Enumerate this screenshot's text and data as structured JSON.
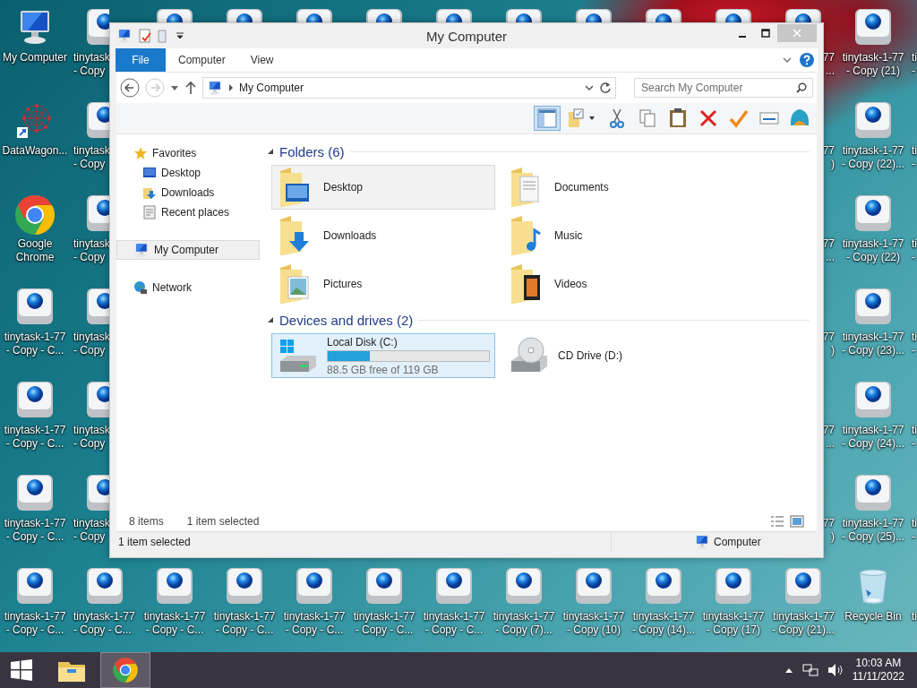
{
  "desktop": {
    "columns": [
      {
        "cut_left": false,
        "cut_right": false,
        "icons": [
          {
            "kind": "computer",
            "lines": [
              "My Computer"
            ]
          },
          {
            "kind": "datawagon",
            "lines": [
              "DataWagon..."
            ]
          },
          {
            "kind": "chrome",
            "lines": [
              "Google",
              "Chrome"
            ]
          },
          {
            "kind": "tinytask",
            "lines": [
              "tinytask-1-77",
              "- Copy - C..."
            ]
          },
          {
            "kind": "tinytask",
            "lines": [
              "tinytask-1-77",
              "- Copy - C..."
            ]
          },
          {
            "kind": "tinytask",
            "lines": [
              "tinytask-1-77",
              "- Copy - C..."
            ]
          },
          {
            "kind": "tinytask",
            "lines": [
              "tinytask-1-77",
              "- Copy - C..."
            ]
          }
        ]
      },
      {
        "cut_left": false,
        "cut_right": true,
        "icons": [
          {
            "kind": "tinytask_left",
            "lines": [
              "tinytask",
              "- Copy"
            ]
          },
          {
            "kind": "tinytask_left",
            "lines": [
              "tinytask",
              "- Copy"
            ]
          },
          {
            "kind": "tinytask_left",
            "lines": [
              "tinytask",
              "- Copy"
            ]
          },
          {
            "kind": "tinytask_left",
            "lines": [
              "tinytask",
              "- Copy"
            ]
          },
          {
            "kind": "tinytask_left",
            "lines": [
              "tinytask",
              "- Copy"
            ]
          },
          {
            "kind": "tinytask_left",
            "lines": [
              "tinytask",
              "- Copy"
            ]
          },
          {
            "kind": "tinytask",
            "lines": [
              "tinytask-1-77",
              "- Copy - C..."
            ]
          }
        ]
      },
      {
        "cut_left": false,
        "cut_right": false,
        "icons": [
          {
            "kind": "tinytask_top"
          },
          {
            "kind": "tinytask",
            "lines": [
              "tinytask-1-77",
              "- Copy - C..."
            ]
          }
        ]
      },
      {
        "cut_left": false,
        "cut_right": false,
        "icons": [
          {
            "kind": "tinytask_top"
          },
          {
            "kind": "tinytask",
            "lines": [
              "tinytask-1-77",
              "- Copy - C..."
            ]
          }
        ]
      },
      {
        "cut_left": false,
        "cut_right": false,
        "icons": [
          {
            "kind": "tinytask_top"
          },
          {
            "kind": "tinytask",
            "lines": [
              "tinytask-1-77",
              "- Copy - C..."
            ]
          }
        ]
      },
      {
        "cut_left": false,
        "cut_right": false,
        "icons": [
          {
            "kind": "tinytask_top"
          },
          {
            "kind": "tinytask",
            "lines": [
              "tinytask-1-77",
              "- Copy - C..."
            ]
          }
        ]
      },
      {
        "cut_left": false,
        "cut_right": false,
        "icons": [
          {
            "kind": "tinytask_top"
          },
          {
            "kind": "tinytask",
            "lines": [
              "tinytask-1-77",
              "- Copy - C..."
            ]
          }
        ]
      },
      {
        "cut_left": false,
        "cut_right": false,
        "icons": [
          {
            "kind": "tinytask_top"
          },
          {
            "kind": "tinytask",
            "lines": [
              "tinytask-1-77",
              "- Copy (7)..."
            ]
          }
        ]
      },
      {
        "cut_left": false,
        "cut_right": false,
        "icons": [
          {
            "kind": "tinytask_top"
          },
          {
            "kind": "tinytask",
            "lines": [
              "tinytask-1-77",
              "- Copy (10)"
            ]
          }
        ]
      },
      {
        "cut_left": false,
        "cut_right": false,
        "icons": [
          {
            "kind": "tinytask_top"
          },
          {
            "kind": "tinytask",
            "lines": [
              "tinytask-1-77",
              "- Copy (14)..."
            ]
          }
        ]
      },
      {
        "cut_left": false,
        "cut_right": false,
        "icons": [
          {
            "kind": "tinytask_top"
          },
          {
            "kind": "tinytask",
            "lines": [
              "tinytask-1-77",
              "- Copy (17)"
            ]
          }
        ]
      },
      {
        "cut_left": true,
        "cut_right": false,
        "icons": [
          {
            "kind": "tinytask_top",
            "lines": [
              "77",
              "..."
            ]
          },
          {
            "kind": "covered",
            "lines": [
              "77",
              ")"
            ]
          },
          {
            "kind": "covered",
            "lines": [
              "77",
              "..."
            ]
          },
          {
            "kind": "covered",
            "lines": [
              "77",
              ")"
            ]
          },
          {
            "kind": "covered",
            "lines": [
              "77",
              "..."
            ]
          },
          {
            "kind": "covered",
            "lines": [
              "77",
              ")"
            ]
          },
          {
            "kind": "tinytask",
            "lines": [
              "tinytask-1-77",
              "- Copy (21)..."
            ]
          }
        ]
      },
      {
        "cut_left": false,
        "cut_right": false,
        "icons": [
          {
            "kind": "tinytask",
            "lines": [
              "tinytask-1-77",
              "- Copy (21)"
            ]
          },
          {
            "kind": "tinytask",
            "lines": [
              "tinytask-1-77",
              "- Copy (22)..."
            ]
          },
          {
            "kind": "tinytask",
            "lines": [
              "tinytask-1-77",
              "- Copy (22)"
            ]
          },
          {
            "kind": "tinytask",
            "lines": [
              "tinytask-1-77",
              "- Copy (23)..."
            ]
          },
          {
            "kind": "tinytask",
            "lines": [
              "tinytask-1-77",
              "- Copy (24)..."
            ]
          },
          {
            "kind": "tinytask",
            "lines": [
              "tinytask-1-77",
              "- Copy (25)..."
            ]
          },
          {
            "kind": "recycle",
            "lines": [
              "Recycle Bin"
            ]
          }
        ]
      },
      {
        "cut_left": false,
        "cut_right": true,
        "icons": [
          {
            "kind": "covered",
            "lines": [
              "ti",
              "-"
            ]
          },
          {
            "kind": "covered",
            "lines": [
              "ti",
              "-"
            ]
          },
          {
            "kind": "covered",
            "lines": [
              "ti",
              "-"
            ]
          },
          {
            "kind": "covered",
            "lines": [
              "ti",
              "-"
            ]
          },
          {
            "kind": "covered",
            "lines": [
              "ti",
              "-"
            ]
          },
          {
            "kind": "covered",
            "lines": [
              "ti",
              "-"
            ]
          },
          {
            "kind": "covered",
            "lines": [
              "ti"
            ]
          }
        ]
      }
    ]
  },
  "window": {
    "title": "My Computer",
    "ribbon_tabs": [
      {
        "label": "File",
        "kind": "file"
      },
      {
        "label": "Computer",
        "kind": "tab"
      },
      {
        "label": "View",
        "kind": "tab"
      }
    ],
    "nav_buttons": {
      "back_disabled": false,
      "forward_disabled": true
    },
    "address": "My Computer",
    "search": {
      "placeholder": "Search My Computer"
    },
    "toolbar": [
      {
        "kind": "pane",
        "on": true
      },
      {
        "kind": "properties",
        "on": false
      },
      {
        "kind": "cut",
        "on": false
      },
      {
        "kind": "copy",
        "on": false
      },
      {
        "kind": "paste",
        "on": false
      },
      {
        "kind": "delete",
        "on": false
      },
      {
        "kind": "check",
        "on": false
      },
      {
        "kind": "rename",
        "on": false
      },
      {
        "kind": "shell",
        "on": false
      }
    ],
    "nav": [
      {
        "label": "Favorites",
        "kind": "star",
        "selected": false,
        "children": [
          {
            "label": "Desktop",
            "kind": "monitor",
            "selected": false
          },
          {
            "label": "Downloads",
            "kind": "downloads",
            "selected": false
          },
          {
            "label": "Recent places",
            "kind": "recent",
            "selected": false
          }
        ]
      },
      {
        "label": "My Computer",
        "kind": "computer",
        "selected": true
      },
      {
        "label": "Network",
        "kind": "network",
        "selected": false
      }
    ],
    "sections": [
      {
        "title": "Folders (6)",
        "items": [
          {
            "label": "Desktop",
            "kind": "desktop",
            "selected": false,
            "hovered": true
          },
          {
            "label": "Documents",
            "kind": "documents",
            "selected": false,
            "hovered": false
          },
          {
            "label": "Downloads",
            "kind": "downloads",
            "selected": false,
            "hovered": false
          },
          {
            "label": "Music",
            "kind": "music",
            "selected": false,
            "hovered": false
          },
          {
            "label": "Pictures",
            "kind": "pictures",
            "selected": false,
            "hovered": false
          },
          {
            "label": "Videos",
            "kind": "videos",
            "selected": false,
            "hovered": false
          }
        ]
      },
      {
        "title": "Devices and drives (2)",
        "items": [
          {
            "label": "Local Disk (C:)",
            "kind": "disk",
            "selected": true,
            "hovered": false,
            "level": 0.26,
            "free": "88.5 GB free of 119 GB"
          },
          {
            "label": "CD Drive (D:)",
            "kind": "cd",
            "selected": false,
            "hovered": false
          }
        ]
      }
    ],
    "footer": {
      "count": "8 items",
      "selection": "1 item selected"
    },
    "status_bar": {
      "text": "1 item selected",
      "location": "Computer"
    }
  },
  "taskbar": {
    "apps": [
      {
        "kind": "explorer",
        "active": false
      },
      {
        "kind": "chrome",
        "active": true
      }
    ],
    "time": "10:03 AM",
    "date": "11/11/2022"
  }
}
